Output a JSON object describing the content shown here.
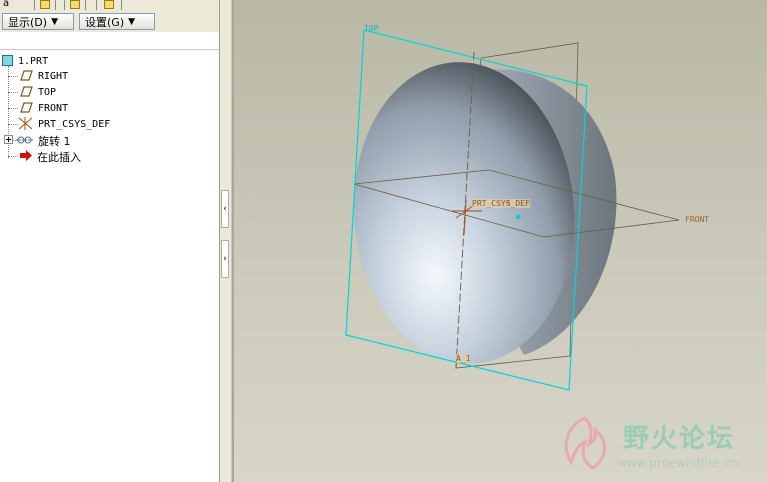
{
  "tabs": {
    "first_tab_letter": "a"
  },
  "toolbar": {
    "show_menu": "显示(D)",
    "settings_menu": "设置(G)"
  },
  "tree": {
    "items": [
      {
        "label": "1.PRT",
        "icon": "part-icon"
      },
      {
        "label": "RIGHT",
        "icon": "datum-plane-icon"
      },
      {
        "label": "TOP",
        "icon": "datum-plane-icon"
      },
      {
        "label": "FRONT",
        "icon": "datum-plane-icon"
      },
      {
        "label": "PRT_CSYS_DEF",
        "icon": "csys-icon"
      },
      {
        "label": "旋转 1",
        "icon": "revolve-icon"
      },
      {
        "label": "在此插入",
        "icon": "insert-here-arrow-icon"
      }
    ]
  },
  "viewport": {
    "plane_top_label": "TOP",
    "plane_front_label": "FRONT",
    "csys_label": "PRT_CSYS_DEF",
    "axis_label": "A_1",
    "colors": {
      "top_plane": "#00d6d6",
      "datum": "#7a6a48",
      "csys": "#a05010"
    }
  },
  "watermark": {
    "title": "野火论坛",
    "url": "www.proewildfire.cn"
  }
}
